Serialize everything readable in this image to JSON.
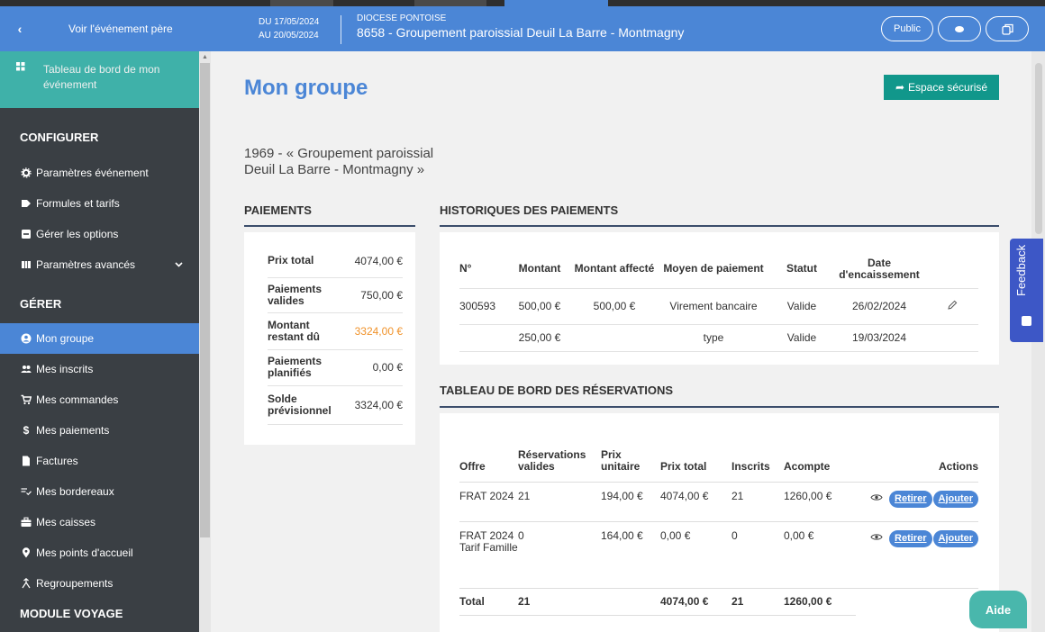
{
  "header": {
    "back_label": "Voir l'événement père",
    "date_from": "DU 17/05/2024",
    "date_to": "AU 20/05/2024",
    "diocese": "DIOCESE PONTOISE",
    "event_title": "8658 - Groupement paroissial Deuil La Barre - Montmagny",
    "public_label": "Public"
  },
  "sidebar": {
    "dashboard_label": "Tableau de bord de mon événement",
    "configurer_title": "CONFIGURER",
    "configurer_items": [
      {
        "label": "Paramètres événement",
        "icon": "gear-icon"
      },
      {
        "label": "Formules et tarifs",
        "icon": "tag-icon"
      },
      {
        "label": "Gérer les options",
        "icon": "minus-square-icon"
      },
      {
        "label": "Paramètres avancés",
        "icon": "table-icon"
      }
    ],
    "gerer_title": "GÉRER",
    "gerer_items": [
      {
        "label": "Mon groupe",
        "icon": "group-icon",
        "active": true
      },
      {
        "label": "Mes inscrits",
        "icon": "users-icon"
      },
      {
        "label": "Mes commandes",
        "icon": "cart-icon"
      },
      {
        "label": "Mes paiements",
        "icon": "dollar-icon"
      },
      {
        "label": "Factures",
        "icon": "file-icon"
      },
      {
        "label": "Mes bordereaux",
        "icon": "list-check-icon"
      },
      {
        "label": "Mes caisses",
        "icon": "briefcase-icon"
      },
      {
        "label": "Mes points d'accueil",
        "icon": "map-marker-icon"
      },
      {
        "label": "Regroupements",
        "icon": "merge-icon"
      }
    ],
    "module_title": "MODULE VOYAGE"
  },
  "main": {
    "title": "Mon groupe",
    "secure_button": "Espace sécurisé",
    "group_name_line1": "1969 - « Groupement paroissial",
    "group_name_line2": "Deuil La Barre - Montmagny »",
    "payments_title": "PAIEMENTS",
    "payments": [
      {
        "label": "Prix total",
        "value": "4074,00 €",
        "highlight": false
      },
      {
        "label": "Paiements valides",
        "value": "750,00 €",
        "highlight": false
      },
      {
        "label": "Montant restant dû",
        "value": "3324,00 €",
        "highlight": true
      },
      {
        "label": "Paiements planifiés",
        "value": "0,00 €",
        "highlight": false
      },
      {
        "label": "Solde prévisionnel",
        "value": "3324,00 €",
        "highlight": false
      }
    ],
    "history_title": "HISTORIQUES DES PAIEMENTS",
    "history_headers": [
      "N°",
      "Montant",
      "Montant affecté",
      "Moyen de paiement",
      "Statut",
      "Date d'encaissement"
    ],
    "history_rows": [
      [
        "300593",
        "500,00 €",
        "500,00 €",
        "Virement bancaire",
        "Valide",
        "26/02/2024"
      ],
      [
        "",
        "250,00 €",
        "",
        "type",
        "Valide",
        "19/03/2024"
      ]
    ],
    "reservations_title": "TABLEAU DE BORD DES RÉSERVATIONS",
    "reservations_headers": [
      "Offre",
      "Réservations valides",
      "Prix unitaire",
      "Prix total",
      "Inscrits",
      "Acompte",
      "Actions"
    ],
    "reservations_rows": [
      [
        "FRAT 2024",
        "21",
        "194,00 €",
        "4074,00 €",
        "21",
        "1260,00 €"
      ],
      [
        "FRAT 2024 Tarif Famille",
        "0",
        "164,00 €",
        "0,00 €",
        "0",
        "0,00 €"
      ]
    ],
    "reservations_total": [
      "Total",
      "21",
      "",
      "4074,00 €",
      "21",
      "1260,00 €"
    ],
    "retirer_label": "Retirer",
    "ajouter_label": "Ajouter"
  },
  "feedback_label": "Feedback",
  "aide_label": "Aide"
}
